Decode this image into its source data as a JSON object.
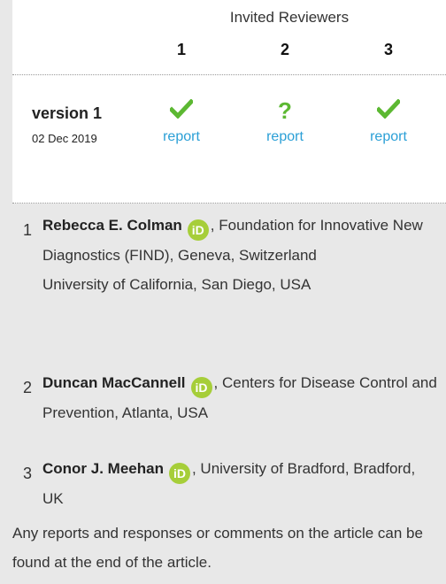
{
  "panel": {
    "header_title": "Invited Reviewers",
    "reviewers": [
      "1",
      "2",
      "3"
    ],
    "version_label": "version 1",
    "version_date": "02 Dec 2019",
    "statuses": [
      {
        "icon": "check-icon",
        "link": "report"
      },
      {
        "icon": "question-icon",
        "glyph": "?",
        "link": "report"
      },
      {
        "icon": "check-icon",
        "link": "report"
      }
    ],
    "colors": {
      "status": "#5cb832",
      "link": "#2a9fd6",
      "orcid": "#a6ce39"
    }
  },
  "affiliations": [
    {
      "num": "1",
      "name": "Rebecca E. Colman",
      "orcid_glyph": "iD",
      "rest": ", Foundation for Innovative New Diagnostics (FIND), Geneva, Switzerland",
      "extra": "University of California, San Diego, USA"
    },
    {
      "num": "2",
      "name": "Duncan MacCannell",
      "orcid_glyph": "iD",
      "rest": ", Centers for Disease Control and Prevention, Atlanta, USA"
    },
    {
      "num": "3",
      "name": "Conor J. Meehan",
      "orcid_glyph": "iD",
      "rest": ", University of Bradford, Bradford, UK"
    }
  ],
  "footer_note": "Any reports and responses or comments on the article can be found at the end of the article."
}
